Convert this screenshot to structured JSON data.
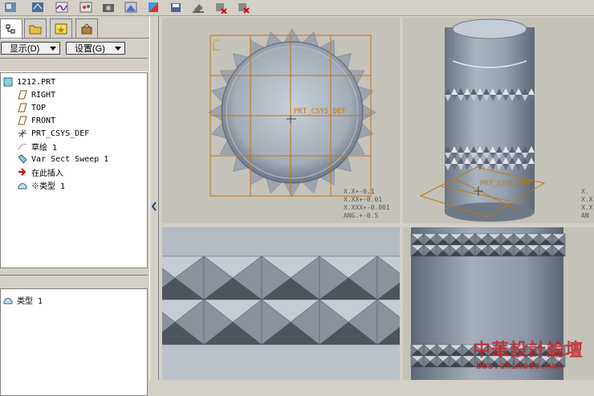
{
  "left_panel": {
    "show_menu_label": "显示(D)",
    "settings_menu_label": "设置(G)",
    "tree_items": [
      {
        "label": "1212.PRT",
        "icon": "part-icon"
      },
      {
        "label": "RIGHT",
        "icon": "datum-plane-icon"
      },
      {
        "label": "TOP",
        "icon": "datum-plane-icon"
      },
      {
        "label": "FRONT",
        "icon": "datum-plane-icon"
      },
      {
        "label": "PRT_CSYS_DEF",
        "icon": "csys-icon"
      },
      {
        "label": "草绘 1",
        "icon": "sketch-icon"
      },
      {
        "label": "Var Sect Sweep 1",
        "icon": "sweep-icon"
      },
      {
        "label": "在此插入",
        "icon": "insert-here-arrow-icon"
      },
      {
        "label": "※类型 1",
        "icon": "feature-type-icon"
      }
    ],
    "lower_items": [
      {
        "label": "类型 1",
        "icon": "feature-type-icon"
      }
    ]
  },
  "viewports": {
    "top_view": {
      "csys_label": "PRT_CSYS_DEF",
      "tolerances": [
        "X.X+-0.1",
        "X.XX+-0.01",
        "X.XXX+-0.001",
        "ANG.+-0.5"
      ]
    },
    "iso_view": {
      "csys_label": "PRT_CSYS_DEF",
      "tolerances": [
        "X.",
        "X.X",
        "X.X",
        "AN"
      ]
    }
  },
  "watermark": {
    "title": "中華設計論壇",
    "url": "bbs.chinade.net"
  },
  "colors": {
    "background_panel": "#d4d0c8",
    "viewport_bg": "#c5c2ba",
    "datum_orange": "#c8780a",
    "model_gray": "#8e9aa8",
    "watermark_red": "#c0282e"
  }
}
